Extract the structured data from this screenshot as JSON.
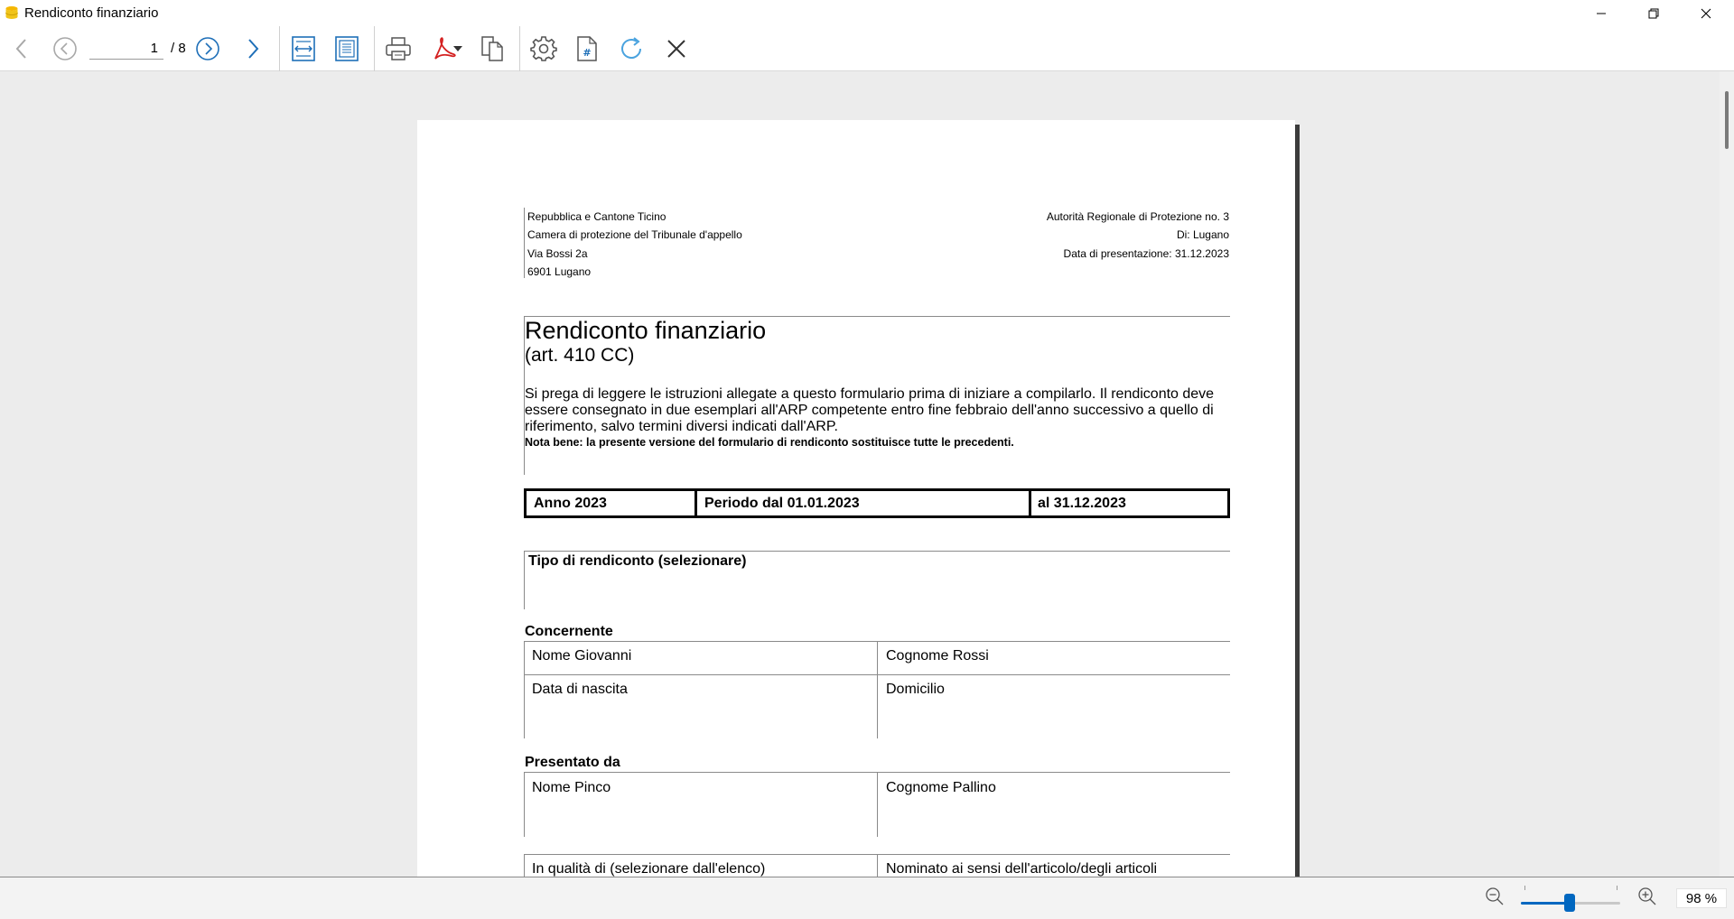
{
  "window": {
    "title": "Rendiconto finanziario",
    "app_icon": "database-icon",
    "controls": [
      "minimize-icon",
      "restore-icon",
      "close-icon"
    ]
  },
  "toolbar": {
    "buttons": [
      {
        "name": "previous-page",
        "icon": "chevron-left-icon"
      },
      {
        "name": "first-page",
        "icon": "circle-chevron-left-icon"
      },
      {
        "name": "last-page",
        "icon": "circle-chevron-right-icon"
      },
      {
        "name": "next-page",
        "icon": "chevron-right-icon"
      },
      {
        "name": "fit-width",
        "icon": "fit-width-icon"
      },
      {
        "name": "fit-page",
        "icon": "fit-page-icon"
      },
      {
        "name": "print",
        "icon": "printer-icon"
      },
      {
        "name": "export-pdf",
        "icon": "pdf-icon"
      },
      {
        "name": "export-options",
        "icon": "dropdown-arrow-icon"
      },
      {
        "name": "copy",
        "icon": "copy-pages-icon"
      },
      {
        "name": "settings",
        "icon": "gear-icon"
      },
      {
        "name": "page-numbering",
        "icon": "hash-document-icon"
      },
      {
        "name": "refresh",
        "icon": "refresh-icon"
      },
      {
        "name": "close-preview",
        "icon": "close-icon"
      }
    ],
    "page_current": "1",
    "page_total": "/ 8"
  },
  "document": {
    "header_left": [
      "Repubblica e Cantone Ticino",
      "Camera di protezione del Tribunale d'appello",
      "Via Bossi 2a",
      "6901 Lugano"
    ],
    "header_right": [
      "Autorità Regionale di Protezione no. 3",
      "Di: Lugano",
      "Data di presentazione: 31.12.2023"
    ],
    "title": "Rendiconto finanziario",
    "subtitle": "(art. 410 CC)",
    "intro": "Si prega di leggere le istruzioni allegate a questo formulario prima di iniziare a compilarlo. Il rendiconto deve essere consegnato in due esemplari all'ARP competente entro fine febbraio dell'anno successivo a quello di riferimento, salvo termini diversi indicati dall'ARP.",
    "note": "Nota bene: la presente versione del formulario di rendiconto sostituisce tutte le precedenti.",
    "period": {
      "anno": "Anno 2023",
      "dal": "Periodo dal 01.01.2023",
      "al": "al 31.12.2023"
    },
    "tipo_label": "Tipo di rendiconto (selezionare)",
    "concernente": {
      "label": "Concernente",
      "nome": "Nome Giovanni",
      "cognome": "Cognome Rossi",
      "nascita": "Data di nascita",
      "domicilio": "Domicilio"
    },
    "presentato": {
      "label": "Presentato da",
      "nome": "Nome Pinco",
      "cognome": "Cognome Pallino",
      "qualita": "In qualità di (selezionare dall'elenco)",
      "nominato": "Nominato ai sensi dell'articolo/degli articoli"
    }
  },
  "statusbar": {
    "zoom_out_icon": "zoom-out-icon",
    "zoom_in_icon": "zoom-in-icon",
    "zoom_level": 98,
    "zoom_text": "98  %"
  },
  "colors": {
    "accent": "#0067c0",
    "toolbar_icon_blue": "#1e6fb8",
    "pdf_red": "#d42020",
    "viewer_bg": "#ececec"
  }
}
